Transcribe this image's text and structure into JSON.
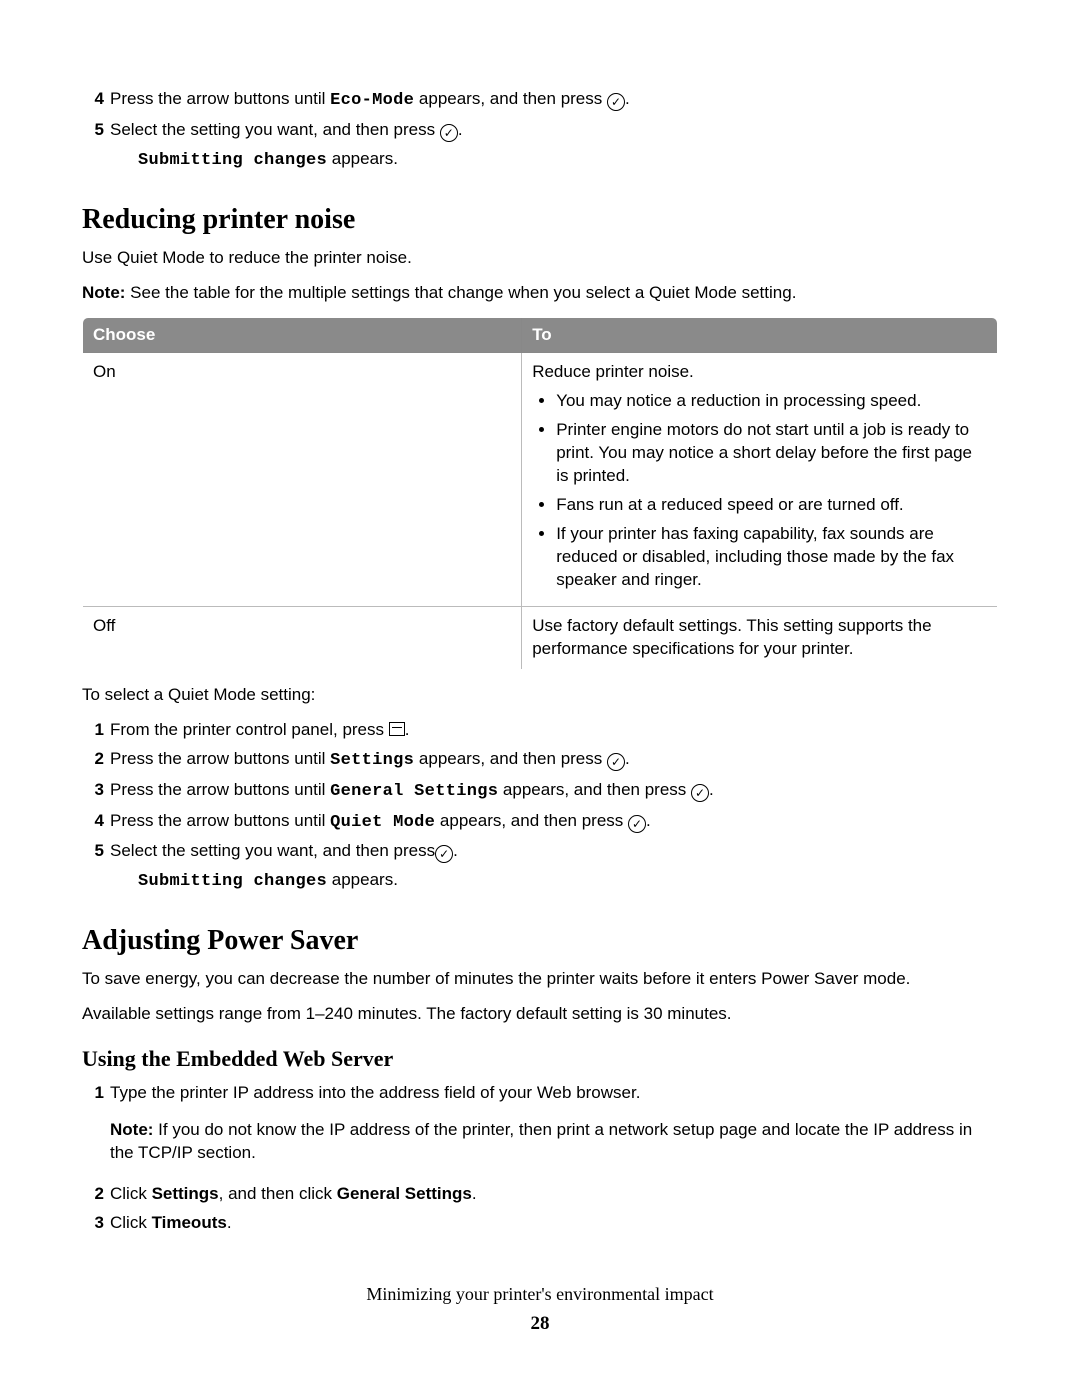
{
  "top_steps": [
    {
      "n": "4",
      "pre": "Press the arrow buttons until ",
      "mono": "Eco-Mode",
      "post": " appears, and then press ",
      "icon": "ok",
      "tail": "."
    },
    {
      "n": "5",
      "pre": "Select the setting you want, and then press ",
      "mono": "",
      "post": "",
      "icon": "ok",
      "tail": ".",
      "sub_mono": "Submitting changes",
      "sub_post": " appears."
    }
  ],
  "reducing": {
    "heading": "Reducing printer noise",
    "intro": "Use Quiet Mode to reduce the printer noise.",
    "note_label": "Note:",
    "note_text": " See the table for the multiple settings that change when you select a Quiet Mode setting.",
    "table": {
      "headers": [
        "Choose",
        "To"
      ],
      "rows": [
        {
          "choose": "On",
          "to_intro": "Reduce printer noise.",
          "bullets": [
            "You may notice a reduction in processing speed.",
            "Printer engine motors do not start until a job is ready to print. You may notice a short delay before the first page is printed.",
            "Fans run at a reduced speed or are turned off.",
            "If your printer has faxing capability, fax sounds are reduced or disabled, including those made by the fax speaker and ringer."
          ]
        },
        {
          "choose": "Off",
          "to_intro": "Use factory default settings. This setting supports the performance specifications for your printer.",
          "bullets": []
        }
      ]
    },
    "select_intro": "To select a Quiet Mode setting:",
    "steps": [
      {
        "n": "1",
        "pre": "From the printer control panel, press ",
        "mono": "",
        "post": "",
        "icon": "menu",
        "tail": "."
      },
      {
        "n": "2",
        "pre": "Press the arrow buttons until ",
        "mono": "Settings",
        "post": " appears, and then press ",
        "icon": "ok",
        "tail": "."
      },
      {
        "n": "3",
        "pre": "Press the arrow buttons until ",
        "mono": "General Settings",
        "post": " appears, and then press ",
        "icon": "ok",
        "tail": "."
      },
      {
        "n": "4",
        "pre": "Press the arrow buttons until ",
        "mono": "Quiet Mode",
        "post": " appears, and then press ",
        "icon": "ok",
        "tail": "."
      },
      {
        "n": "5",
        "pre": "Select the setting you want, and then press",
        "mono": "",
        "post": "",
        "icon": "ok",
        "tail": ".",
        "sub_mono": "Submitting changes",
        "sub_post": " appears."
      }
    ]
  },
  "power": {
    "heading": "Adjusting Power Saver",
    "p1": "To save energy, you can decrease the number of minutes the printer waits before it enters Power Saver mode.",
    "p2": "Available settings range from 1–240 minutes. The factory default setting is 30 minutes.",
    "sub_heading": "Using the Embedded Web Server",
    "steps": [
      {
        "n": "1",
        "text": "Type the printer IP address into the address field of your Web browser.",
        "note_label": "Note:",
        "note_text": " If you do not know the IP address of the printer, then print a network setup page and locate the IP address in the TCP/IP section."
      },
      {
        "n": "2",
        "text_pre": "Click ",
        "b1": "Settings",
        "mid": ", and then click ",
        "b2": "General Settings",
        "tail": "."
      },
      {
        "n": "3",
        "text_pre": "Click ",
        "b1": "Timeouts",
        "tail": "."
      }
    ]
  },
  "footer": {
    "text": "Minimizing your printer's environmental impact",
    "page": "28"
  }
}
